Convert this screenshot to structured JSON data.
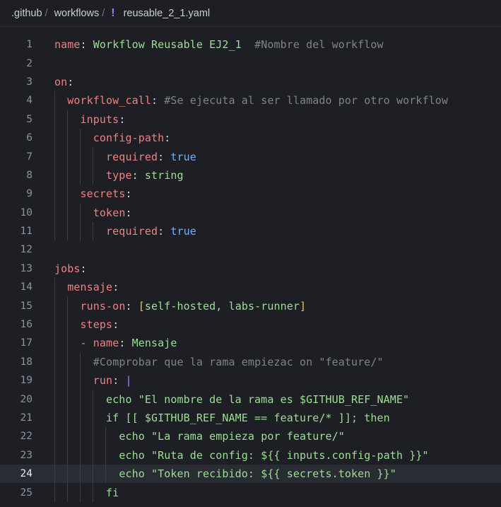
{
  "breadcrumb": {
    "parts": [
      ".github",
      "workflows"
    ],
    "separator": "/",
    "file_icon": "!",
    "file_name": "reusable_2_1.yaml"
  },
  "editor": {
    "active_line": 24,
    "lines": [
      {
        "n": "1",
        "tokens": [
          [
            "k",
            "name"
          ],
          [
            "p",
            ": "
          ],
          [
            "s",
            "Workflow Reusable EJ2_1"
          ],
          [
            "p",
            "  "
          ],
          [
            "c",
            "#Nombre del workflow"
          ]
        ]
      },
      {
        "n": "2",
        "tokens": []
      },
      {
        "n": "3",
        "tokens": [
          [
            "k",
            "on"
          ],
          [
            "p",
            ":"
          ]
        ]
      },
      {
        "n": "4",
        "tokens": [
          [
            "p",
            "  "
          ],
          [
            "k",
            "workflow_call"
          ],
          [
            "p",
            ": "
          ],
          [
            "c",
            "#Se ejecuta al ser llamado por otro workflow"
          ]
        ]
      },
      {
        "n": "5",
        "tokens": [
          [
            "p",
            "    "
          ],
          [
            "k",
            "inputs"
          ],
          [
            "p",
            ":"
          ]
        ]
      },
      {
        "n": "6",
        "tokens": [
          [
            "p",
            "      "
          ],
          [
            "k",
            "config-path"
          ],
          [
            "p",
            ":"
          ]
        ]
      },
      {
        "n": "7",
        "tokens": [
          [
            "p",
            "        "
          ],
          [
            "k",
            "required"
          ],
          [
            "p",
            ": "
          ],
          [
            "b",
            "true"
          ]
        ]
      },
      {
        "n": "8",
        "tokens": [
          [
            "p",
            "        "
          ],
          [
            "k",
            "type"
          ],
          [
            "p",
            ": "
          ],
          [
            "s",
            "string"
          ]
        ]
      },
      {
        "n": "9",
        "tokens": [
          [
            "p",
            "    "
          ],
          [
            "k",
            "secrets"
          ],
          [
            "p",
            ":"
          ]
        ]
      },
      {
        "n": "10",
        "tokens": [
          [
            "p",
            "      "
          ],
          [
            "k",
            "token"
          ],
          [
            "p",
            ":"
          ]
        ]
      },
      {
        "n": "11",
        "tokens": [
          [
            "p",
            "        "
          ],
          [
            "k",
            "required"
          ],
          [
            "p",
            ": "
          ],
          [
            "b",
            "true"
          ]
        ]
      },
      {
        "n": "12",
        "tokens": []
      },
      {
        "n": "13",
        "tokens": [
          [
            "k",
            "jobs"
          ],
          [
            "p",
            ":"
          ]
        ]
      },
      {
        "n": "14",
        "tokens": [
          [
            "p",
            "  "
          ],
          [
            "k",
            "mensaje"
          ],
          [
            "p",
            ":"
          ]
        ]
      },
      {
        "n": "15",
        "tokens": [
          [
            "p",
            "    "
          ],
          [
            "k",
            "runs-on"
          ],
          [
            "p",
            ": "
          ],
          [
            "y",
            "["
          ],
          [
            "s",
            "self-hosted, labs-runner"
          ],
          [
            "y",
            "]"
          ]
        ]
      },
      {
        "n": "16",
        "tokens": [
          [
            "p",
            "    "
          ],
          [
            "k",
            "steps"
          ],
          [
            "p",
            ":"
          ]
        ]
      },
      {
        "n": "17",
        "tokens": [
          [
            "p",
            "    "
          ],
          [
            "k",
            "- "
          ],
          [
            "k",
            "name"
          ],
          [
            "p",
            ": "
          ],
          [
            "s",
            "Mensaje"
          ]
        ]
      },
      {
        "n": "18",
        "tokens": [
          [
            "p",
            "      "
          ],
          [
            "c",
            "#Comprobar que la rama empiezac on \"feature/\""
          ]
        ]
      },
      {
        "n": "19",
        "tokens": [
          [
            "p",
            "      "
          ],
          [
            "k",
            "run"
          ],
          [
            "p",
            ": "
          ],
          [
            "pipe",
            "|"
          ]
        ]
      },
      {
        "n": "20",
        "tokens": [
          [
            "p",
            "        "
          ],
          [
            "s",
            "echo \"El nombre de la rama es $GITHUB_REF_NAME\""
          ]
        ]
      },
      {
        "n": "21",
        "tokens": [
          [
            "p",
            "        "
          ],
          [
            "s",
            "if [[ $GITHUB_REF_NAME == feature/* ]]; then"
          ]
        ]
      },
      {
        "n": "22",
        "tokens": [
          [
            "p",
            "          "
          ],
          [
            "s",
            "echo \"La rama empieza por feature/\""
          ]
        ]
      },
      {
        "n": "23",
        "tokens": [
          [
            "p",
            "          "
          ],
          [
            "s",
            "echo \"Ruta de config: ${{ inputs.config-path }}\""
          ]
        ]
      },
      {
        "n": "24",
        "tokens": [
          [
            "p",
            "          "
          ],
          [
            "s",
            "echo \"Token recibido: ${{ secrets.token }}\""
          ]
        ]
      },
      {
        "n": "25",
        "tokens": [
          [
            "p",
            "        "
          ],
          [
            "s",
            "fi"
          ]
        ]
      }
    ]
  }
}
